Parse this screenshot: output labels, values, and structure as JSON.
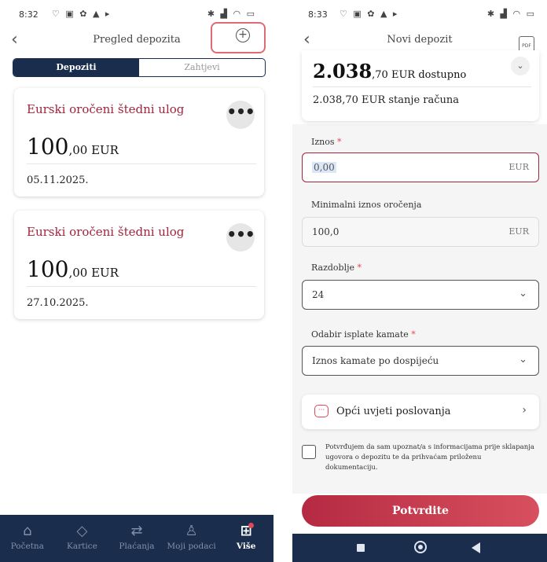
{
  "left": {
    "status": {
      "time": "8:32",
      "left_icons": "♡ ▣ ✿ ▲ ▸",
      "right_icons": "✱ ▟ ◠ ▭"
    },
    "header": {
      "title": "Pregled depozita",
      "back_icon": "‹",
      "add_icon": "+"
    },
    "tabs": [
      {
        "label": "Depoziti",
        "active": true
      },
      {
        "label": "Zahtjevi",
        "active": false
      }
    ],
    "deposits": [
      {
        "title": "Eurski oročeni štedni ulog",
        "amount_int": "100",
        "amount_dec": ",00 EUR",
        "date": "05.11.2025.",
        "menu": "•••"
      },
      {
        "title": "Eurski oročeni štedni ulog",
        "amount_int": "100",
        "amount_dec": ",00 EUR",
        "date": "27.10.2025.",
        "menu": "•••"
      }
    ],
    "nav": [
      {
        "label": "Početna",
        "icon": "⌂"
      },
      {
        "label": "Kartice",
        "icon": "◇"
      },
      {
        "label": "Plaćanja",
        "icon": "⇄"
      },
      {
        "label": "Moji podaci",
        "icon": "♙"
      },
      {
        "label": "Više",
        "icon": "⊞"
      }
    ]
  },
  "right": {
    "status": {
      "time": "8:33",
      "left_icons": "♡ ▣ ✿ ▲ ▸",
      "right_icons": "✱ ▟ ◠ ▭"
    },
    "header": {
      "title": "Novi depozit",
      "back_icon": "‹",
      "pdf_icon": "PDF"
    },
    "account": {
      "available_int": "2.038",
      "available_rest": ",70 EUR dostupno",
      "balance": "2.038,70 EUR stanje računa",
      "chevron": "⌄"
    },
    "form": {
      "amount": {
        "label": "Iznos",
        "required": "*",
        "value": "0,00",
        "unit": "EUR"
      },
      "min_amount": {
        "label": "Minimalni iznos oročenja",
        "value": "100,0",
        "unit": "EUR"
      },
      "period": {
        "label": "Razdoblje",
        "required": "*",
        "value": "24",
        "chevron": "⌄"
      },
      "interest": {
        "label": "Odabir isplate kamate",
        "required": "*",
        "value": "Iznos kamate po dospijeću",
        "chevron": "⌄"
      }
    },
    "terms": {
      "label": "Opći uvjeti poslovanja",
      "icon": "···",
      "chevron": "›"
    },
    "consent": "Potvrđujem da sam upoznat/a s informacijama prije sklapanja ugovora o depozitu te da prihvaćam priloženu dokumentaciju.",
    "confirm_button": "Potvrdite"
  }
}
